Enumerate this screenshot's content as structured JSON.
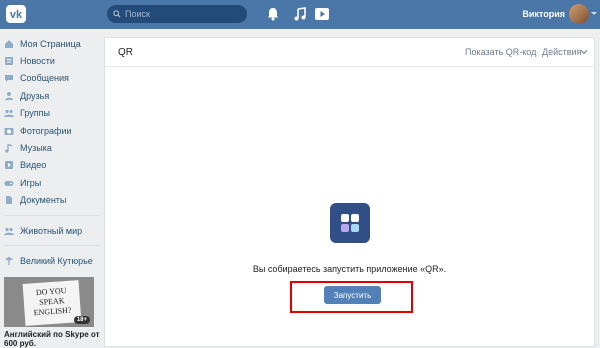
{
  "topbar": {
    "search": {
      "placeholder": "Поиск"
    },
    "username": "Виктория"
  },
  "sidebar": {
    "items": [
      {
        "label": "Моя Страница",
        "icon": "home-icon"
      },
      {
        "label": "Новости",
        "icon": "news-icon"
      },
      {
        "label": "Сообщения",
        "icon": "messages-icon"
      },
      {
        "label": "Друзья",
        "icon": "friends-icon"
      },
      {
        "label": "Группы",
        "icon": "groups-icon"
      },
      {
        "label": "Фотографии",
        "icon": "photo-icon"
      },
      {
        "label": "Музыка",
        "icon": "music-icon"
      },
      {
        "label": "Видео",
        "icon": "video-icon"
      },
      {
        "label": "Игры",
        "icon": "games-icon"
      },
      {
        "label": "Документы",
        "icon": "documents-icon"
      }
    ],
    "extra_items": [
      {
        "label": "Животный мир",
        "icon": "group-icon"
      },
      {
        "label": "Великий Кутюрье",
        "icon": "group-icon"
      }
    ],
    "ad": {
      "image_text": "DO YOU SPEAK ENGLISH?",
      "badge": "18+",
      "title": "Английский по Skype от 600 руб."
    }
  },
  "panel": {
    "title": "QR",
    "show_qr_label": "Показать QR-код",
    "actions_label": "Действия",
    "app_prompt": "Вы собираетесь запустить приложение «QR».",
    "launch_label": "Запустить"
  },
  "colors": {
    "header_bg": "#4a76a8",
    "button_bg": "#5181b8",
    "app_icon_bg": "#314e87",
    "highlight": "#e00000"
  }
}
